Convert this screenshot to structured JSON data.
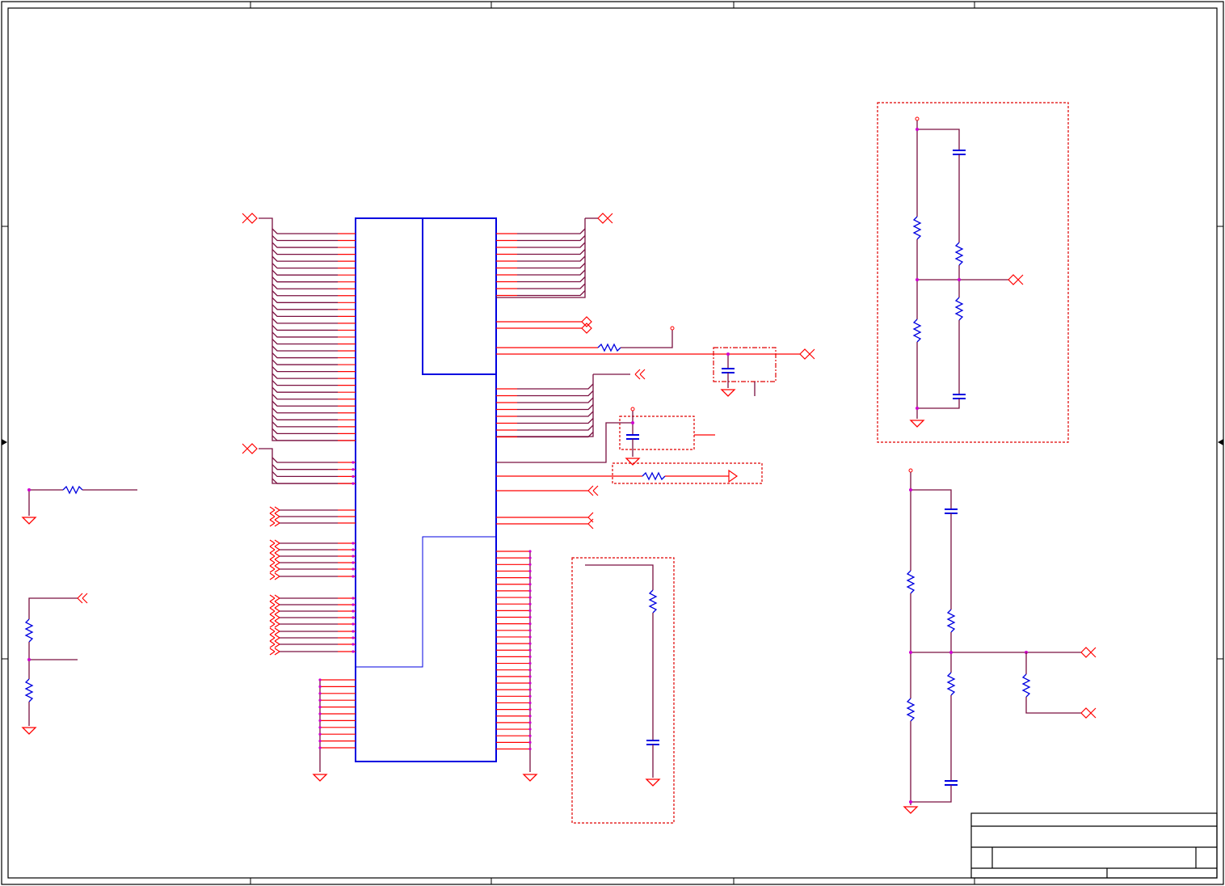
{
  "colors": {
    "frame": "#000000",
    "ic_body": "#0000e0",
    "pin": "#ff0000",
    "wire": "#7a1040",
    "component": "#0000e0",
    "junction": "#d000d0"
  }
}
